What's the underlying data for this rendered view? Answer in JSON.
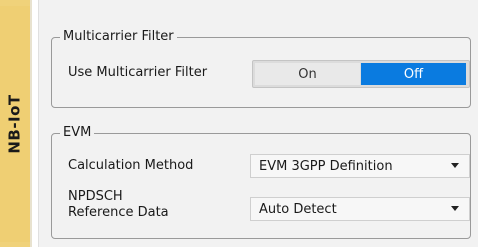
{
  "sidebar": {
    "title": "NB-IoT"
  },
  "multicarrier": {
    "group_title": "Multicarrier Filter",
    "label": "Use Multicarrier Filter",
    "options": [
      "On",
      "Off"
    ],
    "selected": "Off"
  },
  "evm": {
    "group_title": "EVM",
    "calc_method": {
      "label": "Calculation Method",
      "value": "EVM 3GPP Definition"
    },
    "npdsch": {
      "label_line1": "NPDSCH",
      "label_line2": "Reference Data",
      "value": "Auto Detect"
    }
  },
  "colors": {
    "sidebar": "#efcf73",
    "panel": "#f2f2f2",
    "selected_toggle": "#0a7be0"
  }
}
